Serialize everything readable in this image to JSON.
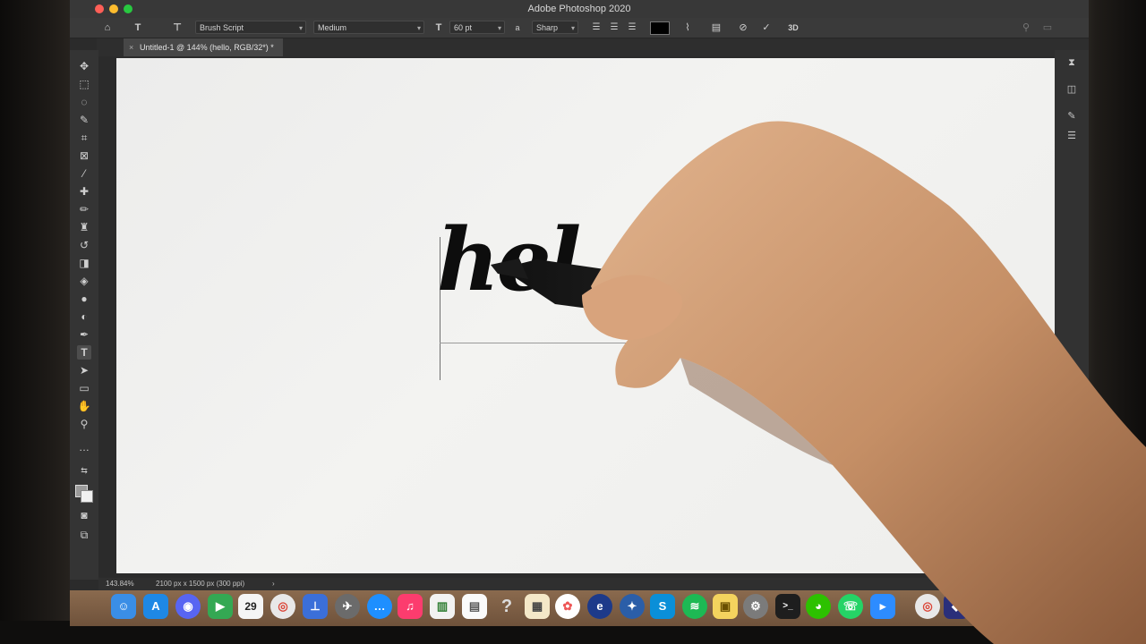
{
  "window": {
    "title": "Adobe Photoshop 2020"
  },
  "options_bar": {
    "font_family": "Brush Script",
    "font_style": "Medium",
    "font_size": "60 pt",
    "aa_glyph": "a",
    "antialias": "Sharp",
    "confirm_icon": "check-icon",
    "cancel_icon": "cancel-icon",
    "three_d": "3D",
    "text_color": "#000000"
  },
  "document": {
    "tab_label": "Untitled-1 @ 144% (hello, RGB/32*) *",
    "tab_close": "×"
  },
  "canvas": {
    "typed_text": "hel"
  },
  "status": {
    "zoom": "143.84%",
    "doc_info": "2100 px x 1500 px (300 ppi)",
    "arrow": "›"
  },
  "dock": {
    "calendar_date": "29",
    "help_glyph": "?"
  },
  "colors": {
    "titlebar": "#383838",
    "close": "#ff5f57",
    "minimize": "#febc2e",
    "zoom": "#28c840",
    "canvas": "#f0f0ee"
  }
}
